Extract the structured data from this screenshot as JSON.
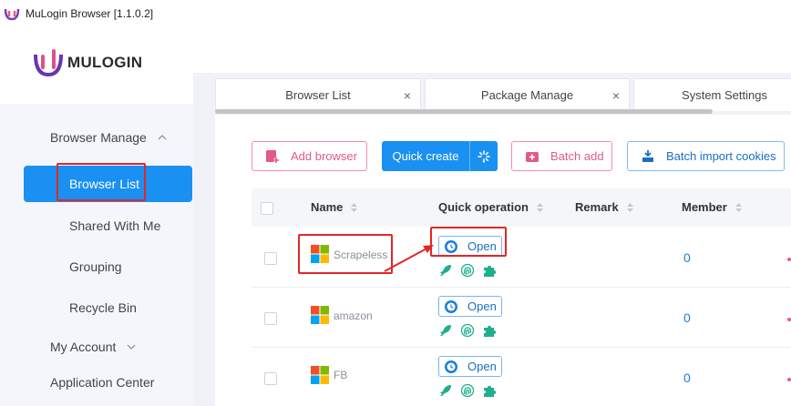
{
  "window": {
    "title": "MuLogin Browser  [1.1.0.2]"
  },
  "logo": {
    "text": "MULOGIN"
  },
  "sidebar": {
    "browser_manage": "Browser Manage",
    "items": [
      {
        "label": "Browser List",
        "active": true
      },
      {
        "label": "Shared With Me"
      },
      {
        "label": "Grouping"
      },
      {
        "label": "Recycle Bin"
      }
    ],
    "my_account": "My Account",
    "application_center": "Application Center"
  },
  "tabs": [
    {
      "label": "Browser List",
      "close": "×"
    },
    {
      "label": "Package Manage",
      "close": "×"
    },
    {
      "label": "System Settings"
    }
  ],
  "toolbar": {
    "add_browser": "Add browser",
    "quick_create": "Quick create",
    "batch_add": "Batch add",
    "batch_import_cookies": "Batch import cookies"
  },
  "table": {
    "columns": [
      "Name",
      "Quick operation",
      "Remark",
      "Member"
    ],
    "rows": [
      {
        "name": "Scrapeless",
        "open": "Open",
        "member": "0"
      },
      {
        "name": "amazon",
        "open": "Open",
        "member": "0"
      },
      {
        "name": "FB",
        "open": "Open",
        "member": "0"
      }
    ]
  },
  "colors": {
    "accent": "#1a90f2",
    "pink": "#e05a8a",
    "highlight": "#e32626",
    "ops_green": "#1fae8e"
  },
  "icons": [
    "mulogin-logo-icon",
    "chevron-up-icon",
    "chevron-down-icon",
    "add-browser-icon",
    "sparkle-icon",
    "batch-add-icon",
    "cookie-import-icon",
    "sort-icon",
    "windows-icon",
    "open-clock-icon",
    "rocket-icon",
    "fingerprint-icon",
    "puzzle-icon"
  ]
}
